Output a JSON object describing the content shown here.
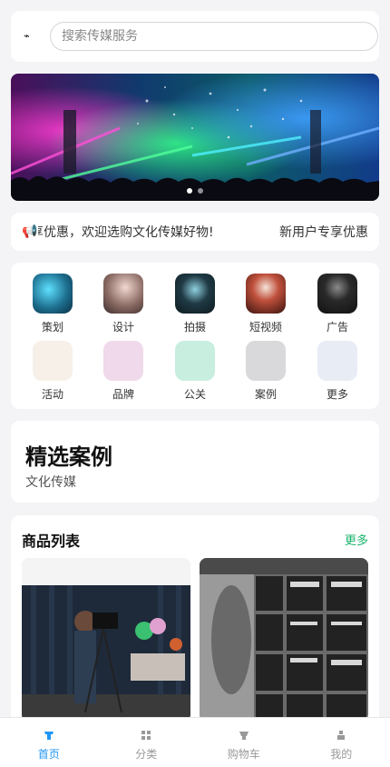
{
  "search": {
    "placeholder": "搜索传媒服务",
    "logo_icon": "lightning-logo-icon"
  },
  "banner": {
    "slide_count": 2,
    "active_index": 0
  },
  "notice": {
    "icon": "megaphone-icon",
    "text": "享优惠，欢迎选购文化传媒好物!",
    "tag": "新用户专享优惠"
  },
  "categories": [
    {
      "label": "策划",
      "color": "#1d6f8f"
    },
    {
      "label": "设计",
      "color": "#8a6a63"
    },
    {
      "label": "拍摄",
      "color": "#1f3a44"
    },
    {
      "label": "短视频",
      "color": "#7a2a22"
    },
    {
      "label": "广告",
      "color": "#2a2a2a"
    },
    {
      "label": "活动",
      "color": "#f6f0e8"
    },
    {
      "label": "品牌",
      "color": "#efd9ea"
    },
    {
      "label": "公关",
      "color": "#c8eedf"
    },
    {
      "label": "案例",
      "color": "#d9d8da"
    },
    {
      "label": "更多",
      "color": "#e8ecf5"
    }
  ],
  "featured": {
    "title": "精选案例",
    "subtitle": "文化传媒"
  },
  "products": {
    "title": "商品列表",
    "more": "更多"
  },
  "tabs": [
    {
      "label": "首页",
      "icon": "home-icon",
      "active": true
    },
    {
      "label": "分类",
      "icon": "grid-icon",
      "active": false
    },
    {
      "label": "购物车",
      "icon": "cart-icon",
      "active": false
    },
    {
      "label": "我的",
      "icon": "user-icon",
      "active": false
    }
  ],
  "colors": {
    "accent": "#2196f3",
    "more_link": "#19b36b"
  }
}
